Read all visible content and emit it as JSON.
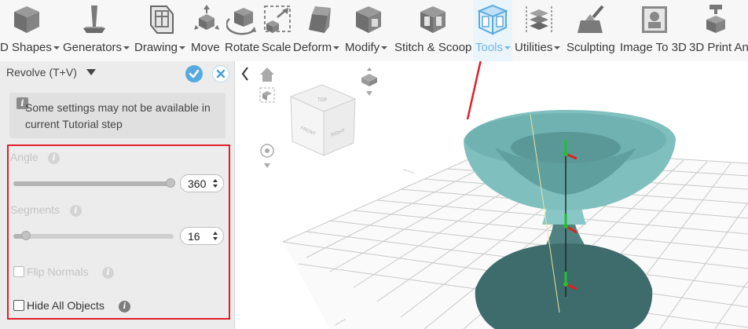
{
  "toolbar": {
    "tools": [
      {
        "id": "3d-shapes",
        "label": "D Shapes",
        "icon": "cube-icon",
        "caret": true
      },
      {
        "id": "generators",
        "label": "Generators",
        "icon": "pillar-icon",
        "caret": true
      },
      {
        "id": "drawing",
        "label": "Drawing",
        "icon": "drawing-icon",
        "caret": true
      },
      {
        "id": "move",
        "label": "Move",
        "icon": "move-arrows-icon",
        "caret": false
      },
      {
        "id": "rotate",
        "label": "Rotate",
        "icon": "rotate-cube-icon",
        "caret": false
      },
      {
        "id": "scale",
        "label": "Scale",
        "icon": "scale-box-icon",
        "caret": false
      },
      {
        "id": "deform",
        "label": "Deform",
        "icon": "deform-icon",
        "caret": true
      },
      {
        "id": "modify",
        "label": "Modify",
        "icon": "modify-cube-icon",
        "caret": true
      },
      {
        "id": "stitch-scoop",
        "label": "Stitch & Scoop",
        "icon": "stitch-scoop-icon",
        "caret": false
      },
      {
        "id": "tools",
        "label": "Tools",
        "icon": "tools-cube-icon",
        "caret": true,
        "active": true
      },
      {
        "id": "utilities",
        "label": "Utilities",
        "icon": "layers-icon",
        "caret": true
      },
      {
        "id": "sculpting",
        "label": "Sculpting",
        "icon": "sculpt-icon",
        "caret": false
      },
      {
        "id": "image-to-3d",
        "label": "Image To 3D",
        "icon": "image-icon",
        "caret": false
      },
      {
        "id": "3d-print",
        "label": "3D Print An",
        "icon": "printer-icon",
        "caret": false
      }
    ]
  },
  "panel": {
    "title": "Revolve (T+V)",
    "notice": "Some settings may not be available in current Tutorial step",
    "settings": {
      "angle_label": "Angle",
      "angle_value": "360",
      "angle_fraction": 1.0,
      "segments_label": "Segments",
      "segments_value": "16",
      "segments_fraction": 0.05,
      "flip_normals_label": "Flip Normals",
      "flip_normals_checked": false,
      "hide_all_label": "Hide All Objects",
      "hide_all_checked": false
    }
  },
  "viewcube": {
    "top": "TOP",
    "front": "FRONT",
    "right": "RIGHT"
  },
  "colors": {
    "accent": "#58a9e0",
    "highlight_border": "#e0202a",
    "model_teal": "#7fbfbe",
    "model_dark": "#3e6b6b"
  }
}
